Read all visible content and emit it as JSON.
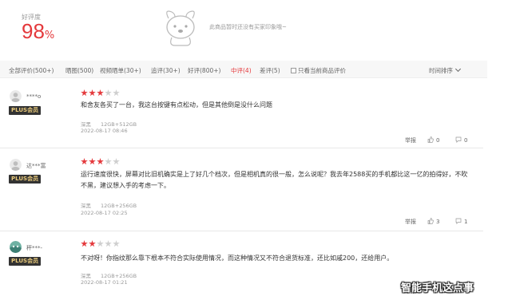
{
  "summary": {
    "rate_label": "好评度",
    "rate_value": "98",
    "rate_unit": "%",
    "impression_text": "此商品暂时还没有买家印象哦~"
  },
  "filters": [
    {
      "label": "全部评价(500+)",
      "active": false
    },
    {
      "label": "晒图(500)",
      "active": false
    },
    {
      "label": "视频晒单(30+)",
      "active": false
    },
    {
      "label": "追评(30+)",
      "active": false
    },
    {
      "label": "好评(800+)",
      "active": false
    },
    {
      "label": "中评(4)",
      "active": true
    },
    {
      "label": "差评(5)",
      "active": false
    }
  ],
  "current_product_filter": "只看当前商品评价",
  "sort_label": "时间排序",
  "reviews": [
    {
      "username": "****o",
      "badge": "PLUS会员",
      "rating": 3,
      "content": "和舍友各买了一台，我这台按键有点松动，但是其他倒是没什么问题",
      "color": "深黑",
      "spec": "12GB+512GB",
      "date": "2022-08-17 08:46",
      "report": "举报",
      "likes": "0",
      "replies": "0"
    },
    {
      "username": "达***富",
      "badge": "PLUS会员",
      "rating": 3,
      "content": "运行速度很快，屏幕对比旧机确实是上了好几个档次，但是相机真的很一般，怎么说呢？我去年2588买的手机都比这一亿的拍得好，不吹不黑，建议想入手的考虑一下。",
      "color": "深黑",
      "spec": "12GB+256GB",
      "date": "2022-08-17 02:25",
      "report": "举报",
      "likes": "3",
      "replies": "1"
    },
    {
      "username": "秤***-",
      "badge": "PLUS会员",
      "rating": 2,
      "content": "不对呀！你指纹那么靠下根本不符合实际使用情况，而这种情况又不符合退货标准，还比如戚200，还给用户。",
      "color": "深黑",
      "spec": "12GB+256GB",
      "date": "2022-08-17 01:21",
      "report": "举报",
      "likes": "",
      "replies": ""
    }
  ],
  "watermark": "智能手机这点事",
  "colors": {
    "accent": "#e4393c",
    "plus_badge_bg": "#333333",
    "plus_badge_text": "#e8c97a"
  }
}
